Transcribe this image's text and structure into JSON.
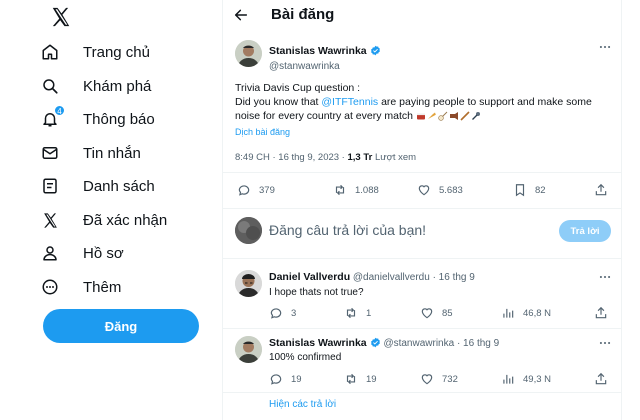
{
  "sidebar": {
    "items": [
      {
        "label": "Trang chủ",
        "icon": "home-icon"
      },
      {
        "label": "Khám phá",
        "icon": "search-icon"
      },
      {
        "label": "Thông báo",
        "icon": "bell-icon",
        "badge": "4"
      },
      {
        "label": "Tin nhắn",
        "icon": "mail-icon"
      },
      {
        "label": "Danh sách",
        "icon": "list-icon"
      },
      {
        "label": "Đã xác nhận",
        "icon": "x-logo-icon"
      },
      {
        "label": "Hồ sơ",
        "icon": "profile-icon"
      },
      {
        "label": "Thêm",
        "icon": "more-circle-icon"
      }
    ],
    "post_button": "Đăng"
  },
  "header": {
    "title": "Bài đăng"
  },
  "tweet": {
    "author_name": "Stanislas Wawrinka",
    "author_handle": "@stanwawrinka",
    "line1": "Trivia Davis Cup question :",
    "line2_before": "Did you know that ",
    "mention": "@ITFTennis",
    "line2_after": " are paying people to support and make some noise for every country at every match",
    "translate": "Dịch bài đăng",
    "time": "8:49 CH · 16 thg 9, 2023 · ",
    "views": "1,3 Tr",
    "views_label": " Lượt xem",
    "stats": {
      "replies": "379",
      "reposts": "1.088",
      "likes": "5.683",
      "bookmarks": "82"
    }
  },
  "composer": {
    "placeholder": "Đăng câu trả lời của bạn!",
    "reply_button": "Trả lời"
  },
  "replies": [
    {
      "name": "Daniel Vallverdu",
      "handle": "@danielvallverdu",
      "date": "· 16 thg 9",
      "text": "I hope thats not true?",
      "stats": {
        "replies": "3",
        "reposts": "1",
        "likes": "85",
        "views": "46,8 N"
      }
    },
    {
      "name": "Stanislas Wawrinka",
      "handle": "@stanwawrinka",
      "date": "· 16 thg 9",
      "text": "100% confirmed",
      "stats": {
        "replies": "19",
        "reposts": "19",
        "likes": "732",
        "views": "49,3 N"
      }
    }
  ],
  "show_replies": "Hiện các trả lời",
  "colors": {
    "accent": "#1d9bf0",
    "accent_disabled": "#8ecdf8",
    "text": "#0f1419",
    "muted": "#536471"
  }
}
